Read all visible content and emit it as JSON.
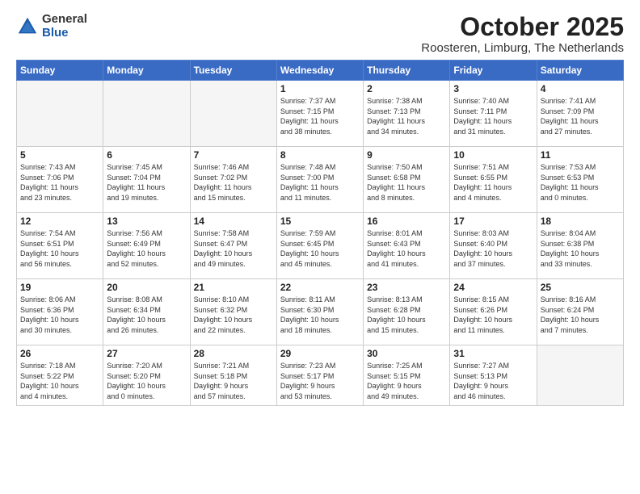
{
  "header": {
    "logo_line1": "General",
    "logo_line2": "Blue",
    "month": "October 2025",
    "location": "Roosteren, Limburg, The Netherlands"
  },
  "weekdays": [
    "Sunday",
    "Monday",
    "Tuesday",
    "Wednesday",
    "Thursday",
    "Friday",
    "Saturday"
  ],
  "weeks": [
    [
      {
        "day": "",
        "info": ""
      },
      {
        "day": "",
        "info": ""
      },
      {
        "day": "",
        "info": ""
      },
      {
        "day": "1",
        "info": "Sunrise: 7:37 AM\nSunset: 7:15 PM\nDaylight: 11 hours\nand 38 minutes."
      },
      {
        "day": "2",
        "info": "Sunrise: 7:38 AM\nSunset: 7:13 PM\nDaylight: 11 hours\nand 34 minutes."
      },
      {
        "day": "3",
        "info": "Sunrise: 7:40 AM\nSunset: 7:11 PM\nDaylight: 11 hours\nand 31 minutes."
      },
      {
        "day": "4",
        "info": "Sunrise: 7:41 AM\nSunset: 7:09 PM\nDaylight: 11 hours\nand 27 minutes."
      }
    ],
    [
      {
        "day": "5",
        "info": "Sunrise: 7:43 AM\nSunset: 7:06 PM\nDaylight: 11 hours\nand 23 minutes."
      },
      {
        "day": "6",
        "info": "Sunrise: 7:45 AM\nSunset: 7:04 PM\nDaylight: 11 hours\nand 19 minutes."
      },
      {
        "day": "7",
        "info": "Sunrise: 7:46 AM\nSunset: 7:02 PM\nDaylight: 11 hours\nand 15 minutes."
      },
      {
        "day": "8",
        "info": "Sunrise: 7:48 AM\nSunset: 7:00 PM\nDaylight: 11 hours\nand 11 minutes."
      },
      {
        "day": "9",
        "info": "Sunrise: 7:50 AM\nSunset: 6:58 PM\nDaylight: 11 hours\nand 8 minutes."
      },
      {
        "day": "10",
        "info": "Sunrise: 7:51 AM\nSunset: 6:55 PM\nDaylight: 11 hours\nand 4 minutes."
      },
      {
        "day": "11",
        "info": "Sunrise: 7:53 AM\nSunset: 6:53 PM\nDaylight: 11 hours\nand 0 minutes."
      }
    ],
    [
      {
        "day": "12",
        "info": "Sunrise: 7:54 AM\nSunset: 6:51 PM\nDaylight: 10 hours\nand 56 minutes."
      },
      {
        "day": "13",
        "info": "Sunrise: 7:56 AM\nSunset: 6:49 PM\nDaylight: 10 hours\nand 52 minutes."
      },
      {
        "day": "14",
        "info": "Sunrise: 7:58 AM\nSunset: 6:47 PM\nDaylight: 10 hours\nand 49 minutes."
      },
      {
        "day": "15",
        "info": "Sunrise: 7:59 AM\nSunset: 6:45 PM\nDaylight: 10 hours\nand 45 minutes."
      },
      {
        "day": "16",
        "info": "Sunrise: 8:01 AM\nSunset: 6:43 PM\nDaylight: 10 hours\nand 41 minutes."
      },
      {
        "day": "17",
        "info": "Sunrise: 8:03 AM\nSunset: 6:40 PM\nDaylight: 10 hours\nand 37 minutes."
      },
      {
        "day": "18",
        "info": "Sunrise: 8:04 AM\nSunset: 6:38 PM\nDaylight: 10 hours\nand 33 minutes."
      }
    ],
    [
      {
        "day": "19",
        "info": "Sunrise: 8:06 AM\nSunset: 6:36 PM\nDaylight: 10 hours\nand 30 minutes."
      },
      {
        "day": "20",
        "info": "Sunrise: 8:08 AM\nSunset: 6:34 PM\nDaylight: 10 hours\nand 26 minutes."
      },
      {
        "day": "21",
        "info": "Sunrise: 8:10 AM\nSunset: 6:32 PM\nDaylight: 10 hours\nand 22 minutes."
      },
      {
        "day": "22",
        "info": "Sunrise: 8:11 AM\nSunset: 6:30 PM\nDaylight: 10 hours\nand 18 minutes."
      },
      {
        "day": "23",
        "info": "Sunrise: 8:13 AM\nSunset: 6:28 PM\nDaylight: 10 hours\nand 15 minutes."
      },
      {
        "day": "24",
        "info": "Sunrise: 8:15 AM\nSunset: 6:26 PM\nDaylight: 10 hours\nand 11 minutes."
      },
      {
        "day": "25",
        "info": "Sunrise: 8:16 AM\nSunset: 6:24 PM\nDaylight: 10 hours\nand 7 minutes."
      }
    ],
    [
      {
        "day": "26",
        "info": "Sunrise: 7:18 AM\nSunset: 5:22 PM\nDaylight: 10 hours\nand 4 minutes."
      },
      {
        "day": "27",
        "info": "Sunrise: 7:20 AM\nSunset: 5:20 PM\nDaylight: 10 hours\nand 0 minutes."
      },
      {
        "day": "28",
        "info": "Sunrise: 7:21 AM\nSunset: 5:18 PM\nDaylight: 9 hours\nand 57 minutes."
      },
      {
        "day": "29",
        "info": "Sunrise: 7:23 AM\nSunset: 5:17 PM\nDaylight: 9 hours\nand 53 minutes."
      },
      {
        "day": "30",
        "info": "Sunrise: 7:25 AM\nSunset: 5:15 PM\nDaylight: 9 hours\nand 49 minutes."
      },
      {
        "day": "31",
        "info": "Sunrise: 7:27 AM\nSunset: 5:13 PM\nDaylight: 9 hours\nand 46 minutes."
      },
      {
        "day": "",
        "info": ""
      }
    ]
  ]
}
